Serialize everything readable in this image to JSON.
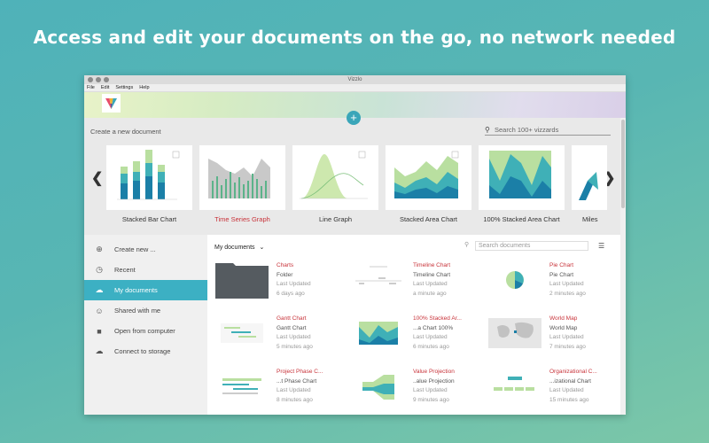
{
  "headline": "Access and edit your documents on the go, no network needed",
  "window": {
    "title": "Vizzlo",
    "menu": [
      "File",
      "Edit",
      "Settings",
      "Help"
    ]
  },
  "gallery": {
    "create_label": "Create a new document",
    "search_placeholder": "Search 100+ vizzards",
    "cards": [
      {
        "label": "Stacked Bar Chart"
      },
      {
        "label": "Time Series Graph"
      },
      {
        "label": "Line Graph"
      },
      {
        "label": "Stacked Area Chart"
      },
      {
        "label": "100% Stacked Area Chart"
      },
      {
        "label": "Miles"
      }
    ]
  },
  "sidebar": {
    "items": [
      {
        "label": "Create new ...",
        "icon": "plus-circle-icon"
      },
      {
        "label": "Recent",
        "icon": "clock-icon"
      },
      {
        "label": "My documents",
        "icon": "cloud-icon"
      },
      {
        "label": "Shared with me",
        "icon": "people-icon"
      },
      {
        "label": "Open from computer",
        "icon": "folder-icon"
      },
      {
        "label": "Connect to storage",
        "icon": "cloud-icon"
      }
    ]
  },
  "documents": {
    "header": "My documents",
    "search_placeholder": "Search documents",
    "items": [
      {
        "name": "Charts",
        "type": "Folder",
        "meta": "Last Updated",
        "time": "6 days ago"
      },
      {
        "name": "Timeline Chart",
        "type": "Timeline Chart",
        "meta": "Last Updated",
        "time": "a minute ago"
      },
      {
        "name": "Pie Chart",
        "type": "Pie Chart",
        "meta": "Last Updated",
        "time": "2 minutes ago"
      },
      {
        "name": "Gantt Chart",
        "type": "Gantt Chart",
        "meta": "Last Updated",
        "time": "5 minutes ago"
      },
      {
        "name": "100% Stacked Ar...",
        "type": "...a Chart 100%",
        "meta": "Last Updated",
        "time": "6 minutes ago"
      },
      {
        "name": "World Map",
        "type": "World Map",
        "meta": "Last Updated",
        "time": "7 minutes ago"
      },
      {
        "name": "Project Phase C...",
        "type": "...t Phase Chart",
        "meta": "Last Updated",
        "time": "8 minutes ago"
      },
      {
        "name": "Value Projection",
        "type": "..alue Projection",
        "meta": "Last Updated",
        "time": "9 minutes ago"
      },
      {
        "name": "Organizational C...",
        "type": "...izational Chart",
        "meta": "Last Updated",
        "time": "15 minutes ago"
      }
    ]
  },
  "colors": {
    "accent": "#3cb0c3",
    "doc_name": "#c8333a"
  }
}
